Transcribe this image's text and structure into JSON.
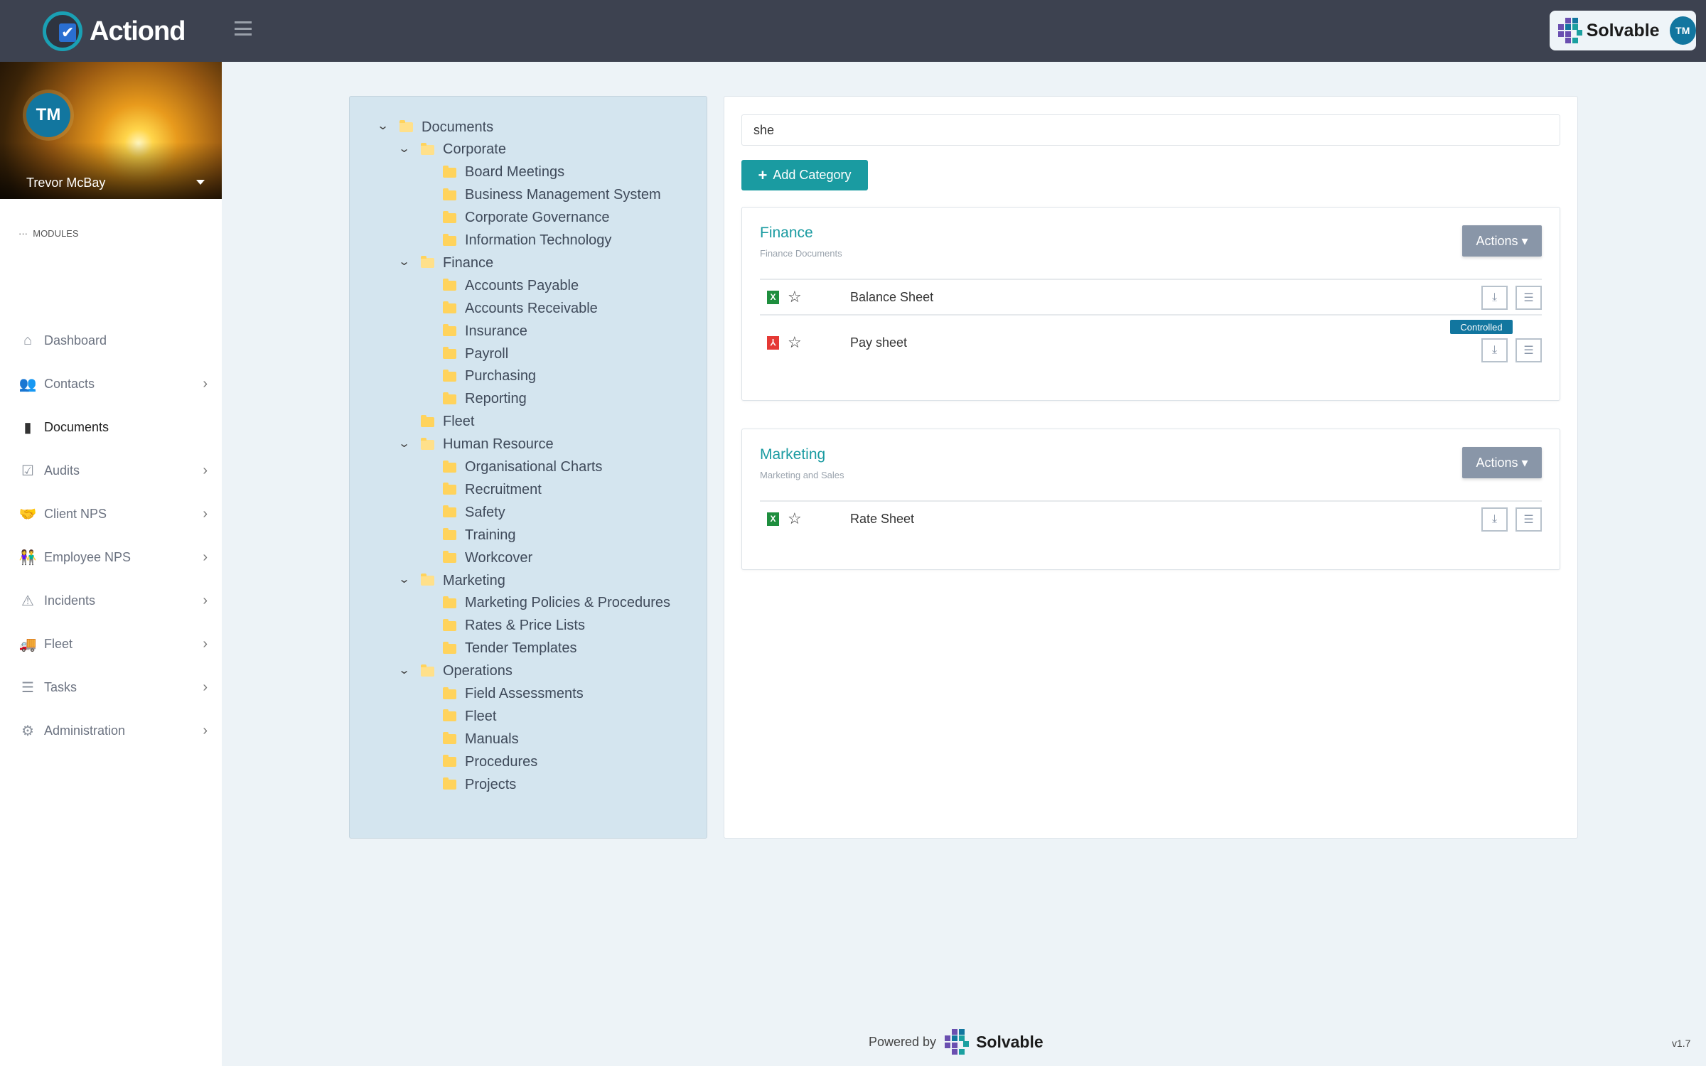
{
  "app": {
    "name": "Actiond",
    "brand": "Solvable",
    "user_initials": "TM"
  },
  "colors": {
    "header": "#3d4250",
    "accent": "#1a9ba1",
    "avatar": "#12769f",
    "actions": "#8996a8",
    "excel": "#1e8e3e",
    "pdf": "#e53935"
  },
  "profile": {
    "initials": "TM",
    "name": "Trevor McBay"
  },
  "sidebar": {
    "section": "MODULES",
    "items": [
      {
        "label": "Dashboard",
        "icon": "home-icon",
        "glyph": "⌂",
        "chevron": false
      },
      {
        "label": "Contacts",
        "icon": "users-icon",
        "glyph": "👥",
        "chevron": true
      },
      {
        "label": "Documents",
        "icon": "file-icon",
        "glyph": "▮",
        "chevron": false,
        "active": true
      },
      {
        "label": "Audits",
        "icon": "clipboard-check-icon",
        "glyph": "☑",
        "chevron": true
      },
      {
        "label": "Client NPS",
        "icon": "handshake-icon",
        "glyph": "🤝",
        "chevron": true
      },
      {
        "label": "Employee NPS",
        "icon": "people-carry-icon",
        "glyph": "👫",
        "chevron": true
      },
      {
        "label": "Incidents",
        "icon": "warning-icon",
        "glyph": "⚠",
        "chevron": true
      },
      {
        "label": "Fleet",
        "icon": "truck-icon",
        "glyph": "🚚",
        "chevron": true
      },
      {
        "label": "Tasks",
        "icon": "tasks-icon",
        "glyph": "☰",
        "chevron": true
      },
      {
        "label": "Administration",
        "icon": "cogs-icon",
        "glyph": "⚙",
        "chevron": true
      }
    ]
  },
  "tree": [
    {
      "label": "Documents",
      "level": 0,
      "expanded": true
    },
    {
      "label": "Corporate",
      "level": 1,
      "expanded": true
    },
    {
      "label": "Board Meetings",
      "level": 2
    },
    {
      "label": "Business Management System",
      "level": 2
    },
    {
      "label": "Corporate Governance",
      "level": 2
    },
    {
      "label": "Information Technology",
      "level": 2
    },
    {
      "label": "Finance",
      "level": 1,
      "expanded": true
    },
    {
      "label": "Accounts Payable",
      "level": 2
    },
    {
      "label": "Accounts Receivable",
      "level": 2
    },
    {
      "label": "Insurance",
      "level": 2
    },
    {
      "label": "Payroll",
      "level": 2
    },
    {
      "label": "Purchasing",
      "level": 2
    },
    {
      "label": "Reporting",
      "level": 2
    },
    {
      "label": "Fleet",
      "level": 1
    },
    {
      "label": "Human Resource",
      "level": 1,
      "expanded": true
    },
    {
      "label": "Organisational Charts",
      "level": 2
    },
    {
      "label": "Recruitment",
      "level": 2
    },
    {
      "label": "Safety",
      "level": 2
    },
    {
      "label": "Training",
      "level": 2
    },
    {
      "label": "Workcover",
      "level": 2
    },
    {
      "label": "Marketing",
      "level": 1,
      "expanded": true
    },
    {
      "label": "Marketing Policies & Procedures",
      "level": 2
    },
    {
      "label": "Rates & Price Lists",
      "level": 2
    },
    {
      "label": "Tender Templates",
      "level": 2
    },
    {
      "label": "Operations",
      "level": 1,
      "expanded": true
    },
    {
      "label": "Field Assessments",
      "level": 2
    },
    {
      "label": "Fleet",
      "level": 2
    },
    {
      "label": "Manuals",
      "level": 2
    },
    {
      "label": "Procedures",
      "level": 2
    },
    {
      "label": "Projects",
      "level": 2
    }
  ],
  "main": {
    "search_value": "she",
    "add_category": "Add Category",
    "categories": [
      {
        "title": "Finance",
        "subtitle": "Finance Documents",
        "actions": "Actions ▾",
        "docs": [
          {
            "name": "Balance Sheet",
            "type": "excel",
            "type_label": "X"
          },
          {
            "name": "Pay sheet",
            "type": "pdf",
            "type_label": "⅄",
            "badge": "Controlled"
          }
        ]
      },
      {
        "title": "Marketing",
        "subtitle": "Marketing and Sales",
        "actions": "Actions ▾",
        "docs": [
          {
            "name": "Rate Sheet",
            "type": "excel",
            "type_label": "X"
          }
        ]
      }
    ]
  },
  "footer": {
    "powered_by": "Powered by",
    "brand": "Solvable",
    "version": "v1.7"
  }
}
